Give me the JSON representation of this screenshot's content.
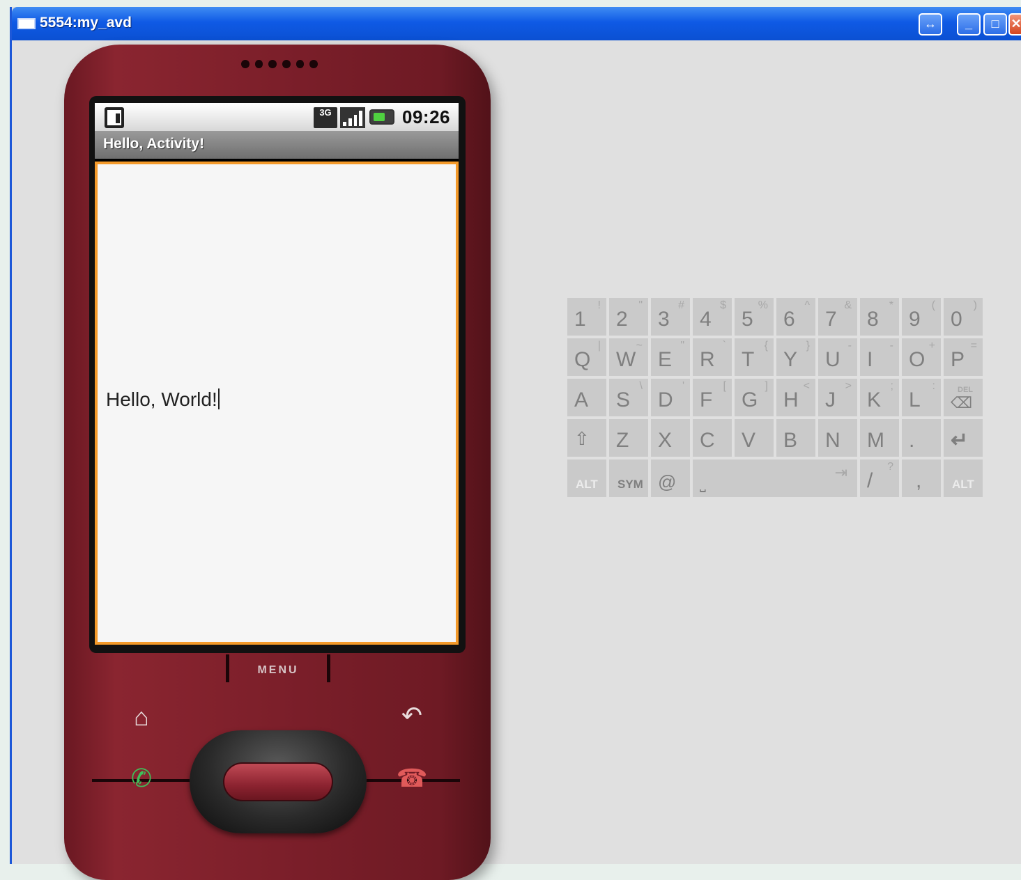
{
  "window": {
    "title": "5554:my_avd",
    "buttons": {
      "swap": "↔",
      "minimize": "_",
      "maximize": "□",
      "close": "✕"
    }
  },
  "phone": {
    "status_bar": {
      "network": "3G",
      "time": "09:26"
    },
    "app_title": "Hello, Activity!",
    "content_text": "Hello, World!",
    "menu_label": "MENU",
    "icons": {
      "home": "home-icon",
      "back": "back-icon",
      "call": "call-icon",
      "end_call": "end-call-icon",
      "sd_card": "sd-card-icon",
      "signal": "signal-icon",
      "battery": "battery-icon"
    }
  },
  "keyboard": {
    "rows": [
      [
        {
          "main": "1",
          "alt": "!"
        },
        {
          "main": "2",
          "alt": "\""
        },
        {
          "main": "3",
          "alt": "#"
        },
        {
          "main": "4",
          "alt": "$"
        },
        {
          "main": "5",
          "alt": "%"
        },
        {
          "main": "6",
          "alt": "^"
        },
        {
          "main": "7",
          "alt": "&"
        },
        {
          "main": "8",
          "alt": "*"
        },
        {
          "main": "9",
          "alt": "("
        },
        {
          "main": "0",
          "alt": ")"
        }
      ],
      [
        {
          "main": "Q",
          "alt": "|"
        },
        {
          "main": "W",
          "alt": "~"
        },
        {
          "main": "E",
          "alt": "\""
        },
        {
          "main": "R",
          "alt": "`"
        },
        {
          "main": "T",
          "alt": "{"
        },
        {
          "main": "Y",
          "alt": "}"
        },
        {
          "main": "U",
          "alt": "-"
        },
        {
          "main": "I",
          "alt": "-"
        },
        {
          "main": "O",
          "alt": "+"
        },
        {
          "main": "P",
          "alt": "="
        }
      ],
      [
        {
          "main": "A",
          "alt": ""
        },
        {
          "main": "S",
          "alt": "\\"
        },
        {
          "main": "D",
          "alt": "'"
        },
        {
          "main": "F",
          "alt": "["
        },
        {
          "main": "G",
          "alt": "]"
        },
        {
          "main": "H",
          "alt": "<"
        },
        {
          "main": "J",
          "alt": ">"
        },
        {
          "main": "K",
          "alt": ";"
        },
        {
          "main": "L",
          "alt": ":"
        },
        {
          "main": "⌫",
          "alt": "DEL"
        }
      ],
      [
        {
          "main": "⇧",
          "alt": ""
        },
        {
          "main": "Z",
          "alt": ""
        },
        {
          "main": "X",
          "alt": ""
        },
        {
          "main": "C",
          "alt": ""
        },
        {
          "main": "V",
          "alt": ""
        },
        {
          "main": "B",
          "alt": ""
        },
        {
          "main": "N",
          "alt": ""
        },
        {
          "main": "M",
          "alt": ""
        },
        {
          "main": ".",
          "alt": ""
        },
        {
          "main": "↵",
          "alt": ""
        }
      ]
    ],
    "bottom_row": {
      "alt_left": "ALT",
      "sym": "SYM",
      "at": "@",
      "space": "⎵",
      "tab": "⇥",
      "slash": "/",
      "slash_alt": "?",
      "comma": ",",
      "alt_right": "ALT"
    }
  }
}
